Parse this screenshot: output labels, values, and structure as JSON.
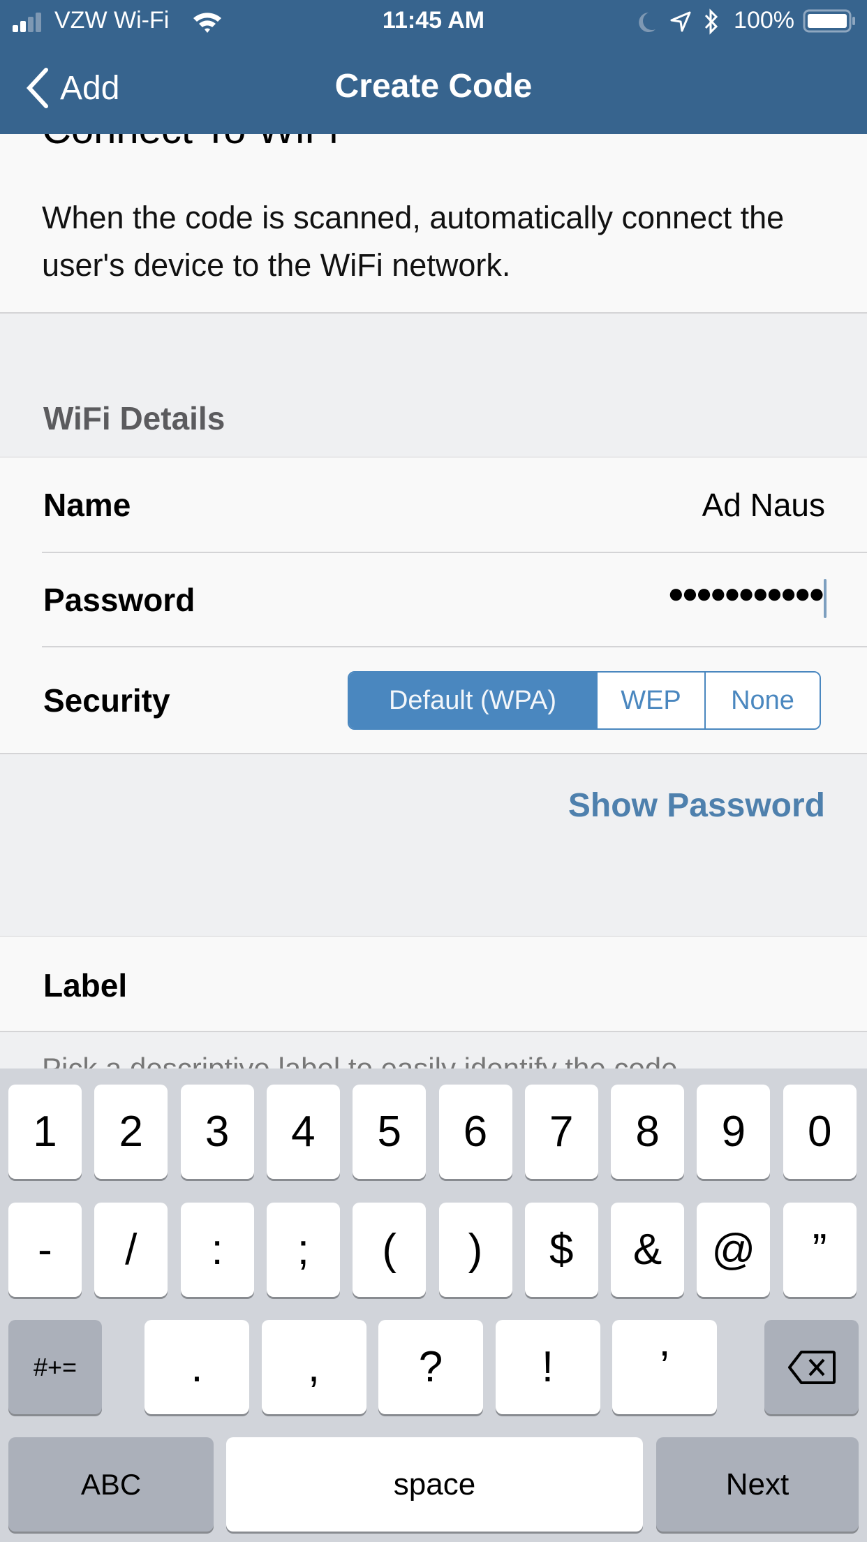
{
  "status_bar": {
    "carrier": "VZW Wi-Fi",
    "signal_bars_filled": 2,
    "signal_bars_total": 4,
    "time": "11:45 AM",
    "battery": "100%",
    "icons": [
      "signal-icon",
      "wifi-icon",
      "moon-icon",
      "location-icon",
      "bluetooth-icon",
      "battery-icon"
    ]
  },
  "nav": {
    "back_label": "Add",
    "title": "Create Code"
  },
  "intro": {
    "title": "Connect To WiFi",
    "description": "When the code is scanned, automatically connect the user's device to the WiFi network."
  },
  "wifi_section": {
    "header": "WiFi Details",
    "name_label": "Name",
    "name_value": "Ad Naus",
    "password_label": "Password",
    "password_value": "●●●●●●●●●●●",
    "security_label": "Security",
    "security_options": [
      "Default (WPA)",
      "WEP",
      "None"
    ],
    "security_selected": "Default (WPA)",
    "show_password": "Show Password"
  },
  "label_section": {
    "label": "Label",
    "hint": "Pick a descriptive label to easily identify the code"
  },
  "keyboard": {
    "row1": [
      "1",
      "2",
      "3",
      "4",
      "5",
      "6",
      "7",
      "8",
      "9",
      "0"
    ],
    "row2": [
      "-",
      "/",
      ":",
      ";",
      "(",
      ")",
      "$",
      "&",
      "@",
      "”"
    ],
    "row3_left": "#+=",
    "row3": [
      ".",
      ",",
      "?",
      "!",
      "’"
    ],
    "abc": "ABC",
    "space": "space",
    "next": "Next"
  },
  "colors": {
    "nav_bar": "#37648e",
    "accent": "#4a87bf",
    "link": "#4e80ad"
  }
}
